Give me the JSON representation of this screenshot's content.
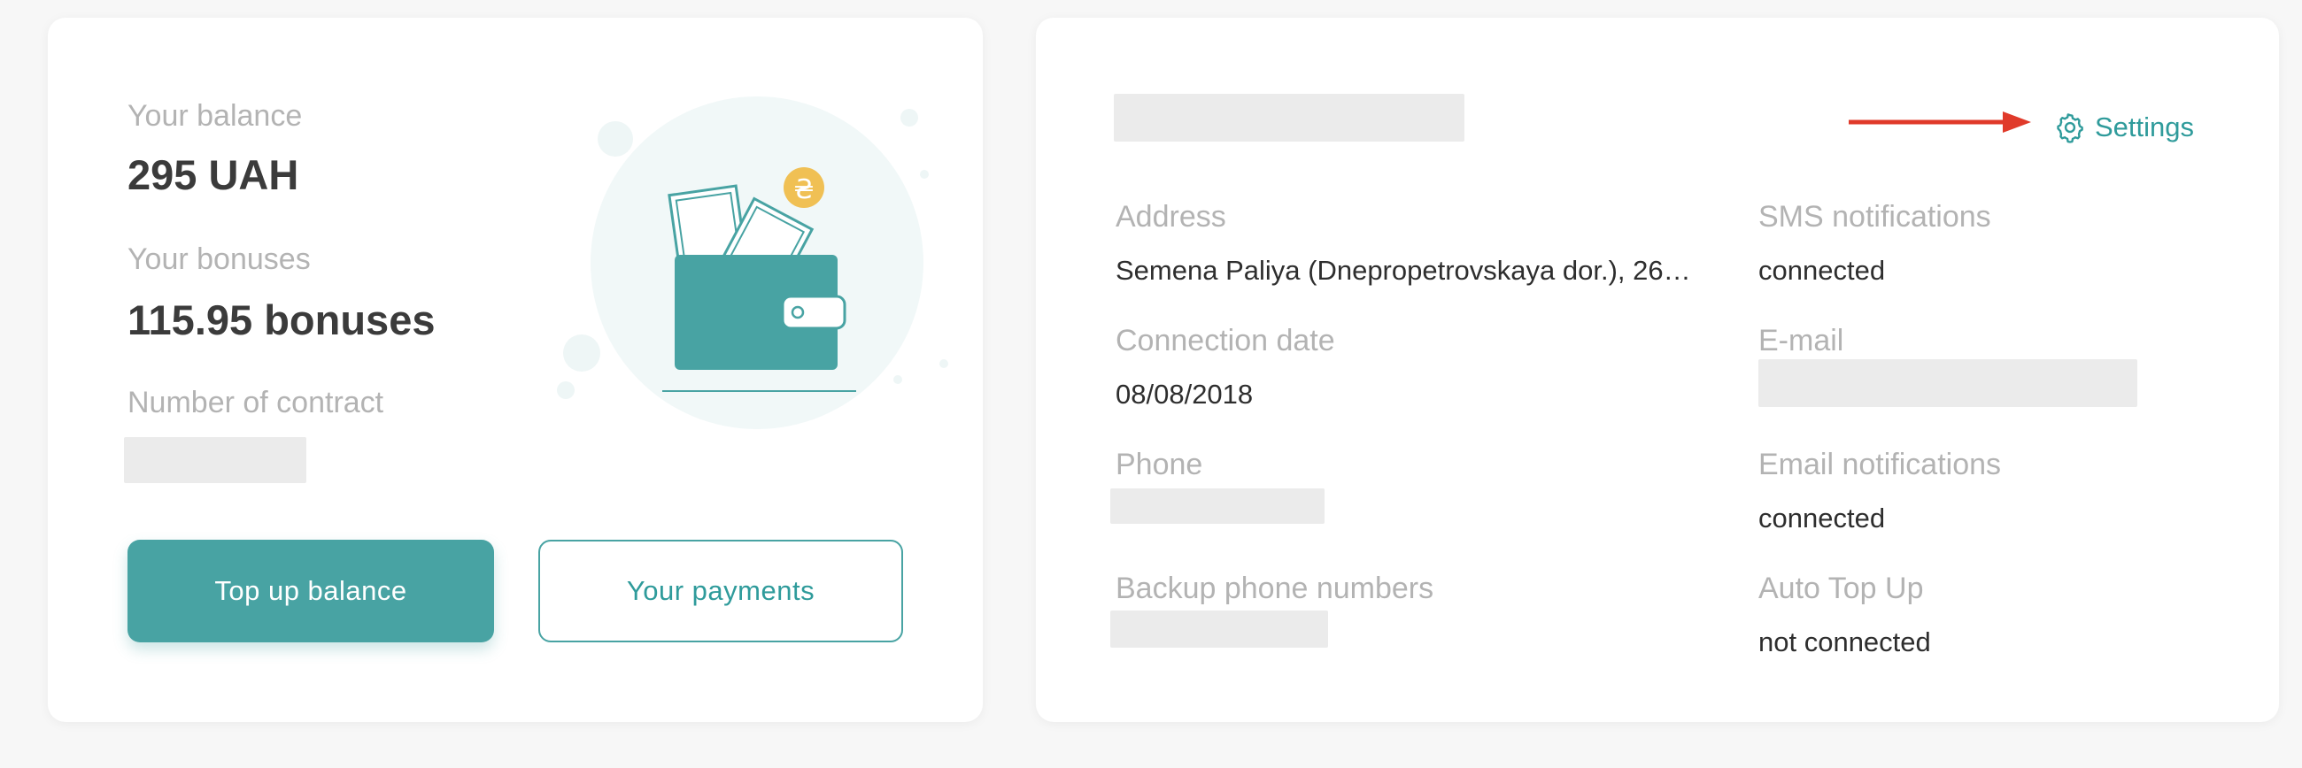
{
  "colors": {
    "accent": "#48a3a3",
    "label": "#b3b3b3",
    "text": "#2e2e2e",
    "arrow": "#e03a2a"
  },
  "balance_card": {
    "balance_label": "Your balance",
    "balance_value": "295 UAH",
    "bonuses_label": "Your bonuses",
    "bonuses_value": "115.95 bonuses",
    "contract_label": "Number of contract",
    "illustration_icon": "wallet-icon",
    "currency_icon": "hryvnia-coin-icon",
    "currency_symbol": "₴",
    "top_up_button": "Top up balance",
    "payments_button": "Your payments"
  },
  "account_card": {
    "settings_label": "Settings",
    "settings_icon": "gear-icon",
    "address_label": "Address",
    "address_value": "Semena Paliya (Dnepropetrovskaya dor.), 26…",
    "connection_date_label": "Connection date",
    "connection_date_value": "08/08/2018",
    "phone_label": "Phone",
    "backup_phones_label": "Backup phone numbers",
    "sms_label": "SMS notifications",
    "sms_value": "connected",
    "email_label": "E-mail",
    "email_notifications_label": "Email notifications",
    "email_notifications_value": "connected",
    "auto_top_up_label": "Auto Top Up",
    "auto_top_up_value": "not connected"
  }
}
